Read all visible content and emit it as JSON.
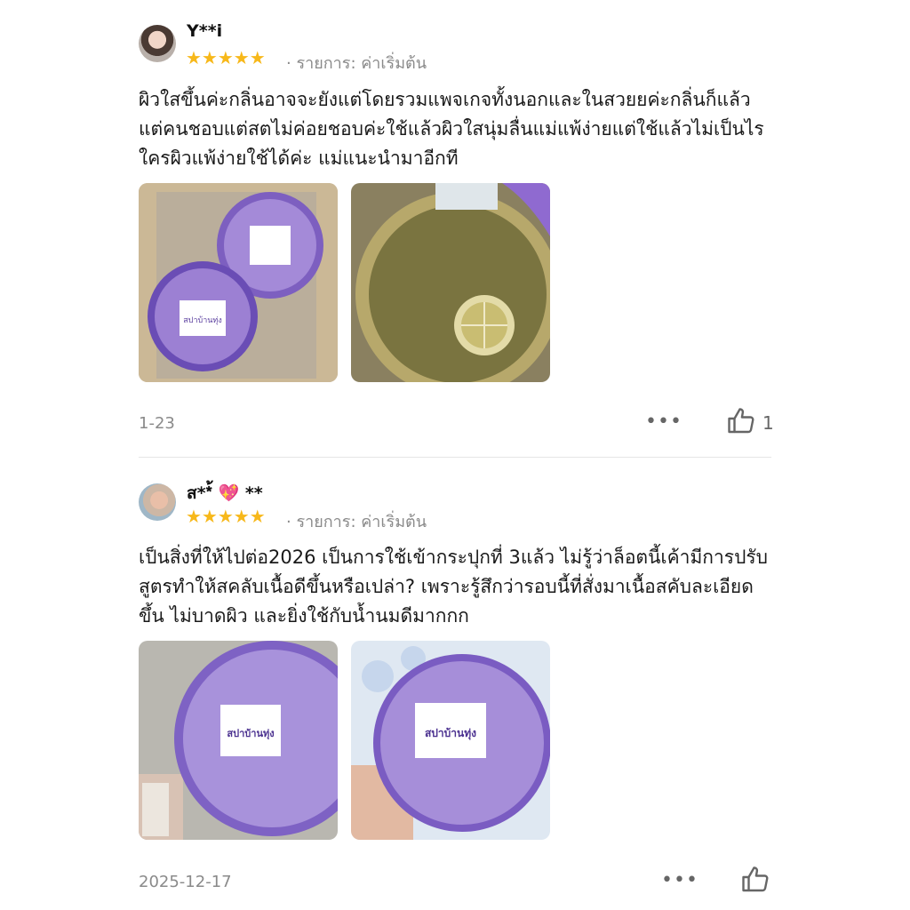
{
  "reviews": [
    {
      "username": "Y**i",
      "stars": "★★★★★",
      "variant": "· รายการ: ค่าเริ่มต้น",
      "text": "ผิวใสขึ้นค่ะกลิ่นอาจจะยังแต่โดยรวมแพจเกจทั้งนอกและในสวยยค่ะกลิ่นก็แล้วแต่คนชอบแต่สตไม่ค่อยชอบค่ะใช้แล้วผิวใสนุ่มลื่นแม่แพ้ง่ายแต่ใช้แล้วไม่เป็นไรใครผิวแพ้ง่ายใช้ได้ค่ะ แม่แนะนำมาอีกที",
      "date": "1-23",
      "more": "•••",
      "likes": "1",
      "photo1_label": "สปาบ้านทุ่ง",
      "photo2_label": ""
    },
    {
      "username": "ส**้ 💖 **",
      "stars": "★★★★★",
      "variant": "· รายการ: ค่าเริ่มต้น",
      "text": "เป็นสิ่งที่ให้ไปต่อ2026 เป็นการใช้เข้ากระปุกที่ 3แล้ว ไม่รู้ว่าล็อตนี้เค้ามีการปรับสูตรทำให้สคลับเนื้อดีขึ้นหรือเปล่า? เพราะรู้สึกว่ารอบนี้ที่สั่งมาเนื้อสคับละเอียดขึ้น ไม่บาดผิว และยิ่งใช้กับน้ำนมดีมากกก",
      "date": "2025-12-17",
      "more": "•••",
      "likes": "",
      "photo1_label": "สปาบ้านทุ่ง",
      "photo2_label": "สปาบ้านทุ่ง"
    }
  ]
}
